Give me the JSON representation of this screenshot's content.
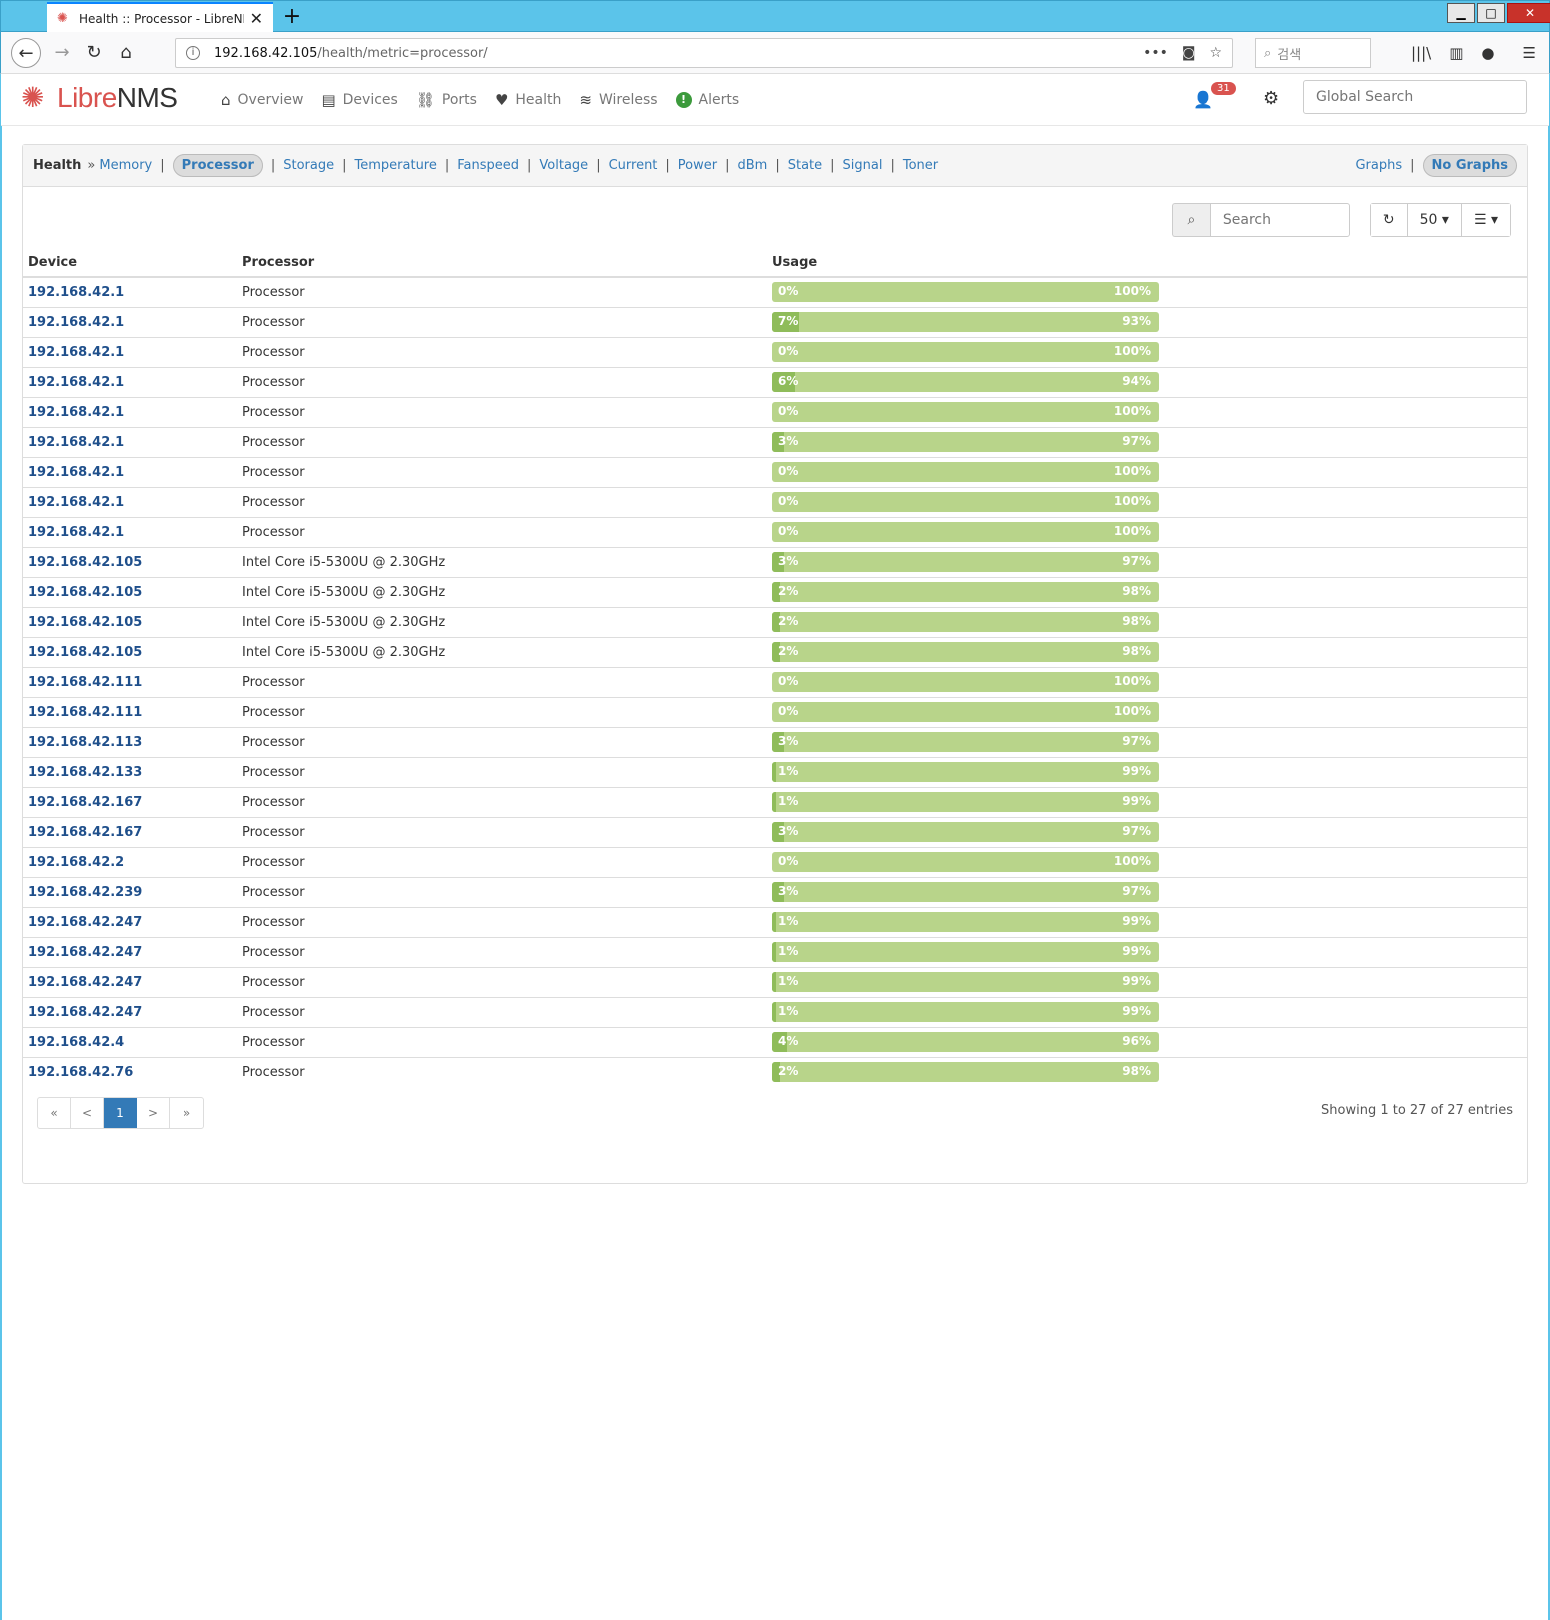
{
  "browser": {
    "tab_title": "Health :: Processor - LibreNMS",
    "url_host": "192.168.42.105",
    "url_path": "/health/metric=processor/",
    "search_placeholder": "검색"
  },
  "app": {
    "logo_libre": "Libre",
    "logo_nms": "NMS",
    "menu": [
      {
        "label": "Overview",
        "icon": "home-icon"
      },
      {
        "label": "Devices",
        "icon": "server-icon"
      },
      {
        "label": "Ports",
        "icon": "link-icon"
      },
      {
        "label": "Health",
        "icon": "heartbeat-icon"
      },
      {
        "label": "Wireless",
        "icon": "wifi-icon"
      },
      {
        "label": "Alerts",
        "icon": "alert-icon"
      }
    ],
    "notification_count": "31",
    "global_search_placeholder": "Global Search"
  },
  "health": {
    "title": "Health",
    "metrics": [
      "Memory",
      "Processor",
      "Storage",
      "Temperature",
      "Fanspeed",
      "Voltage",
      "Current",
      "Power",
      "dBm",
      "State",
      "Signal",
      "Toner"
    ],
    "active_metric": "Processor",
    "graphs_label": "Graphs",
    "no_graphs_label": "No Graphs"
  },
  "table": {
    "search_placeholder": "Search",
    "page_size": "50",
    "columns": [
      "Device",
      "Processor",
      "Usage"
    ],
    "rows": [
      {
        "device": "192.168.42.1",
        "processor": "Processor",
        "used": "0%",
        "free": "100%",
        "pct": 0
      },
      {
        "device": "192.168.42.1",
        "processor": "Processor",
        "used": "7%",
        "free": "93%",
        "pct": 7
      },
      {
        "device": "192.168.42.1",
        "processor": "Processor",
        "used": "0%",
        "free": "100%",
        "pct": 0
      },
      {
        "device": "192.168.42.1",
        "processor": "Processor",
        "used": "6%",
        "free": "94%",
        "pct": 6
      },
      {
        "device": "192.168.42.1",
        "processor": "Processor",
        "used": "0%",
        "free": "100%",
        "pct": 0
      },
      {
        "device": "192.168.42.1",
        "processor": "Processor",
        "used": "3%",
        "free": "97%",
        "pct": 3
      },
      {
        "device": "192.168.42.1",
        "processor": "Processor",
        "used": "0%",
        "free": "100%",
        "pct": 0
      },
      {
        "device": "192.168.42.1",
        "processor": "Processor",
        "used": "0%",
        "free": "100%",
        "pct": 0
      },
      {
        "device": "192.168.42.1",
        "processor": "Processor",
        "used": "0%",
        "free": "100%",
        "pct": 0
      },
      {
        "device": "192.168.42.105",
        "processor": "Intel Core i5-5300U @ 2.30GHz",
        "used": "3%",
        "free": "97%",
        "pct": 3
      },
      {
        "device": "192.168.42.105",
        "processor": "Intel Core i5-5300U @ 2.30GHz",
        "used": "2%",
        "free": "98%",
        "pct": 2
      },
      {
        "device": "192.168.42.105",
        "processor": "Intel Core i5-5300U @ 2.30GHz",
        "used": "2%",
        "free": "98%",
        "pct": 2
      },
      {
        "device": "192.168.42.105",
        "processor": "Intel Core i5-5300U @ 2.30GHz",
        "used": "2%",
        "free": "98%",
        "pct": 2
      },
      {
        "device": "192.168.42.111",
        "processor": "Processor",
        "used": "0%",
        "free": "100%",
        "pct": 0
      },
      {
        "device": "192.168.42.111",
        "processor": "Processor",
        "used": "0%",
        "free": "100%",
        "pct": 0
      },
      {
        "device": "192.168.42.113",
        "processor": "Processor",
        "used": "3%",
        "free": "97%",
        "pct": 3
      },
      {
        "device": "192.168.42.133",
        "processor": "Processor",
        "used": "1%",
        "free": "99%",
        "pct": 1
      },
      {
        "device": "192.168.42.167",
        "processor": "Processor",
        "used": "1%",
        "free": "99%",
        "pct": 1
      },
      {
        "device": "192.168.42.167",
        "processor": "Processor",
        "used": "3%",
        "free": "97%",
        "pct": 3
      },
      {
        "device": "192.168.42.2",
        "processor": "Processor",
        "used": "0%",
        "free": "100%",
        "pct": 0
      },
      {
        "device": "192.168.42.239",
        "processor": "Processor",
        "used": "3%",
        "free": "97%",
        "pct": 3
      },
      {
        "device": "192.168.42.247",
        "processor": "Processor",
        "used": "1%",
        "free": "99%",
        "pct": 1
      },
      {
        "device": "192.168.42.247",
        "processor": "Processor",
        "used": "1%",
        "free": "99%",
        "pct": 1
      },
      {
        "device": "192.168.42.247",
        "processor": "Processor",
        "used": "1%",
        "free": "99%",
        "pct": 1
      },
      {
        "device": "192.168.42.247",
        "processor": "Processor",
        "used": "1%",
        "free": "99%",
        "pct": 1
      },
      {
        "device": "192.168.42.4",
        "processor": "Processor",
        "used": "4%",
        "free": "96%",
        "pct": 4
      },
      {
        "device": "192.168.42.76",
        "processor": "Processor",
        "used": "2%",
        "free": "98%",
        "pct": 2
      }
    ],
    "pager": [
      "«",
      "<",
      "1",
      ">",
      "»"
    ],
    "current_page": "1",
    "info": "Showing 1 to 27 of 27 entries"
  }
}
